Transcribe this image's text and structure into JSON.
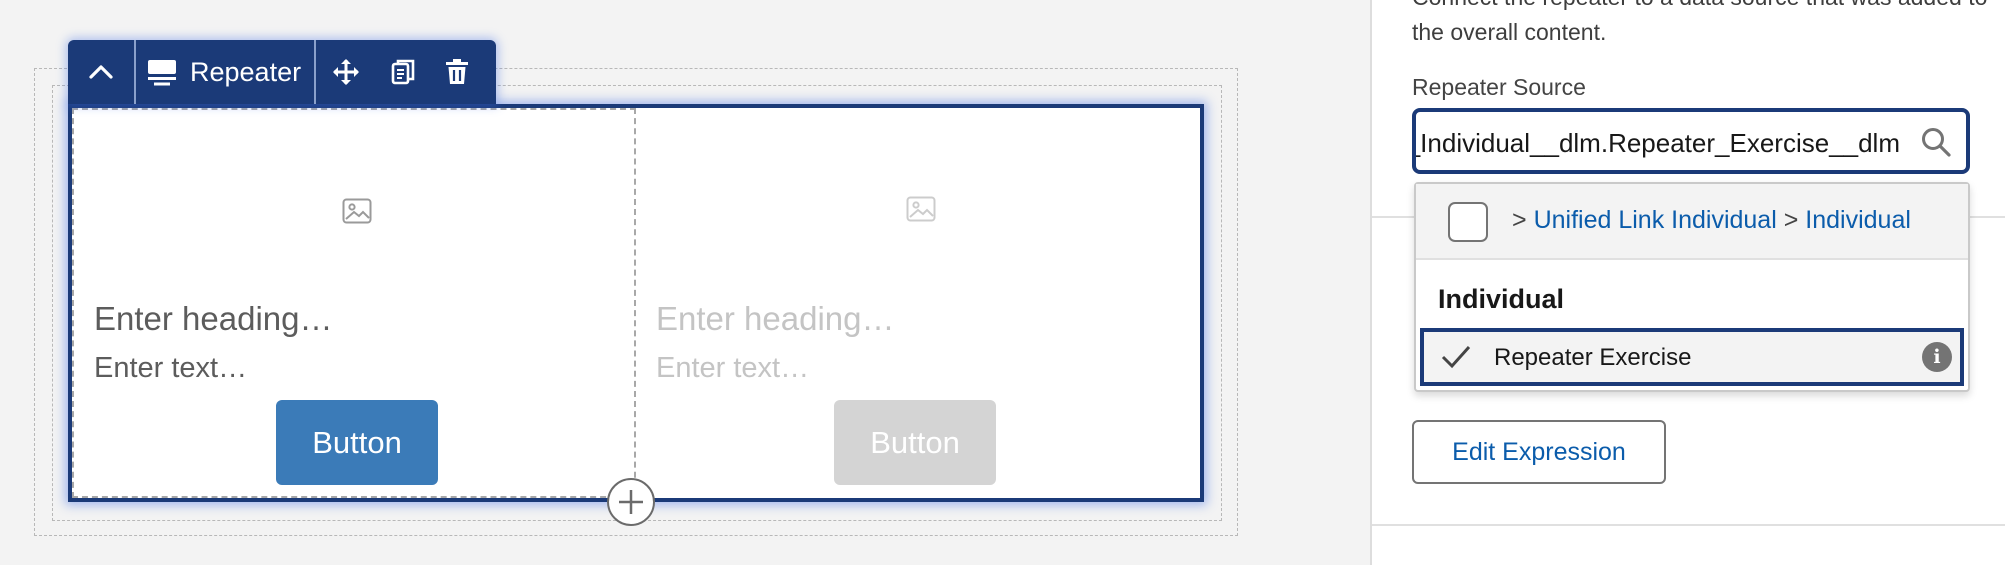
{
  "toolbar": {
    "component_label": "Repeater"
  },
  "repeater": {
    "items": [
      {
        "heading": "Enter heading…",
        "text": "Enter text…",
        "button": "Button"
      },
      {
        "heading": "Enter heading…",
        "text": "Enter text…",
        "button": "Button"
      }
    ]
  },
  "panel": {
    "description": "Connect the repeater to a data source that was added to the overall content.",
    "source_label": "Repeater Source",
    "source_value": "Unified_Link_Individual__dlm.Repeater_Exercise__dlm",
    "dropdown": {
      "path_prefix": ">",
      "path_link_1": "Unified Link Individual",
      "path_sep": ">",
      "path_link_2": "Individual",
      "group_heading": "Individual",
      "selected_option": "Repeater Exercise",
      "info_icon": "i"
    },
    "edit_button": "Edit Expression"
  },
  "colors": {
    "toolbar_bg": "#1b3a78",
    "primary_button": "#3b7bb8",
    "disabled_button": "#d4d4d4",
    "link": "#0b5cab"
  }
}
